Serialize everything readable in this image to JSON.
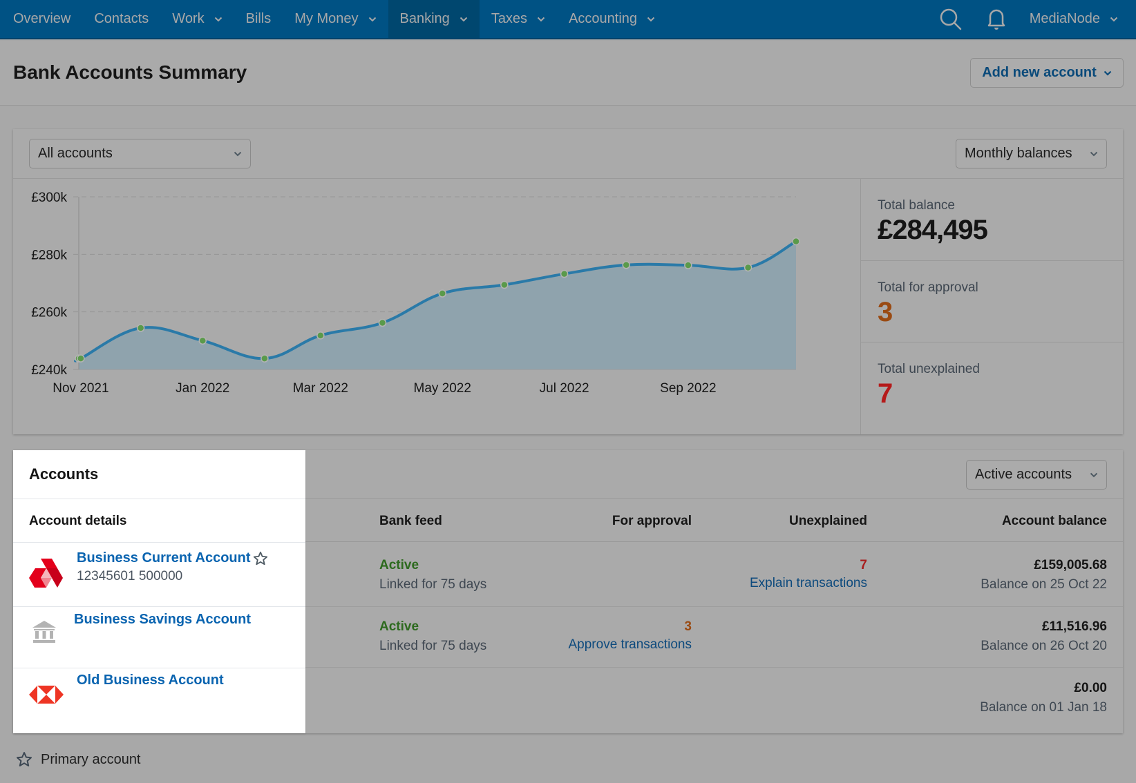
{
  "nav": {
    "items": [
      {
        "label": "Overview",
        "has_menu": false,
        "active": false
      },
      {
        "label": "Contacts",
        "has_menu": false,
        "active": false
      },
      {
        "label": "Work",
        "has_menu": true,
        "active": false
      },
      {
        "label": "Bills",
        "has_menu": false,
        "active": false
      },
      {
        "label": "My Money",
        "has_menu": true,
        "active": false
      },
      {
        "label": "Banking",
        "has_menu": true,
        "active": true
      },
      {
        "label": "Taxes",
        "has_menu": true,
        "active": false
      },
      {
        "label": "Accounting",
        "has_menu": true,
        "active": false
      }
    ],
    "icons": [
      "search-icon",
      "bell-icon"
    ],
    "user": "MediaNode",
    "colors": {
      "bar": "#005284",
      "active": "#00476f"
    }
  },
  "header": {
    "title": "Bank Accounts Summary",
    "add_button": "Add new account"
  },
  "summary": {
    "account_filter": "All accounts",
    "period_select": "Monthly balances",
    "stats": {
      "total_balance_label": "Total balance",
      "total_balance_value": "£284,495",
      "for_approval_label": "Total for approval",
      "for_approval_value": "3",
      "unexplained_label": "Total unexplained",
      "unexplained_value": "7"
    }
  },
  "chart_data": {
    "type": "area",
    "title": "",
    "xlabel": "",
    "ylabel": "",
    "x_tick_labels": [
      "Nov 2021",
      "Jan 2022",
      "Mar 2022",
      "May 2022",
      "Jul 2022",
      "Sep 2022"
    ],
    "y_tick_labels": [
      "£240k",
      "£260k",
      "£280k",
      "£300k"
    ],
    "y_ticks": [
      240000,
      260000,
      280000,
      300000
    ],
    "ylim": [
      240000,
      300000
    ],
    "grid": true,
    "series": [
      {
        "name": "Monthly balance",
        "color": "#2a7aa8",
        "fill": "#8fa3ad",
        "marker_color": "#5a9a4a",
        "x": [
          "2021-10-31",
          "2021-11-01",
          "2021-12-01",
          "2022-01-01",
          "2022-02-01",
          "2022-03-01",
          "2022-04-01",
          "2022-05-01",
          "2022-06-01",
          "2022-07-01",
          "2022-08-01",
          "2022-09-01",
          "2022-10-01",
          "2022-10-25"
        ],
        "values": [
          243800,
          243800,
          254400,
          250000,
          243800,
          251800,
          256200,
          266400,
          269400,
          273200,
          276300,
          276200,
          275400,
          284495
        ]
      }
    ]
  },
  "accounts": {
    "title": "Accounts",
    "filter": "Active accounts",
    "columns": {
      "details": "Account details",
      "bank_feed": "Bank feed",
      "for_approval": "For approval",
      "unexplained": "Unexplained",
      "balance": "Account balance"
    },
    "rows": [
      {
        "name": "Business Current Account",
        "number": "12345601 500000",
        "logo": "natwest-logo-icon",
        "primary": true,
        "feed_status": "Active",
        "feed_detail": "Linked for 75 days",
        "for_approval": "",
        "approve_link": "",
        "unexplained": "7",
        "explain_link": "Explain transactions",
        "balance": "£159,005.68",
        "balance_date": "Balance on 25 Oct 22"
      },
      {
        "name": "Business Savings Account",
        "number": "",
        "logo": "bank-building-icon",
        "primary": false,
        "feed_status": "Active",
        "feed_detail": "Linked for 75 days",
        "for_approval": "3",
        "approve_link": "Approve transactions",
        "unexplained": "",
        "explain_link": "",
        "balance": "£11,516.96",
        "balance_date": "Balance on 26 Oct 20"
      },
      {
        "name": "Old Business Account",
        "number": "",
        "logo": "hsbc-logo-icon",
        "primary": false,
        "feed_status": "",
        "feed_detail": "",
        "for_approval": "",
        "approve_link": "",
        "unexplained": "",
        "explain_link": "",
        "balance": "£0.00",
        "balance_date": "Balance on 01 Jan 18"
      }
    ]
  },
  "legend": {
    "primary_account": "Primary account"
  }
}
